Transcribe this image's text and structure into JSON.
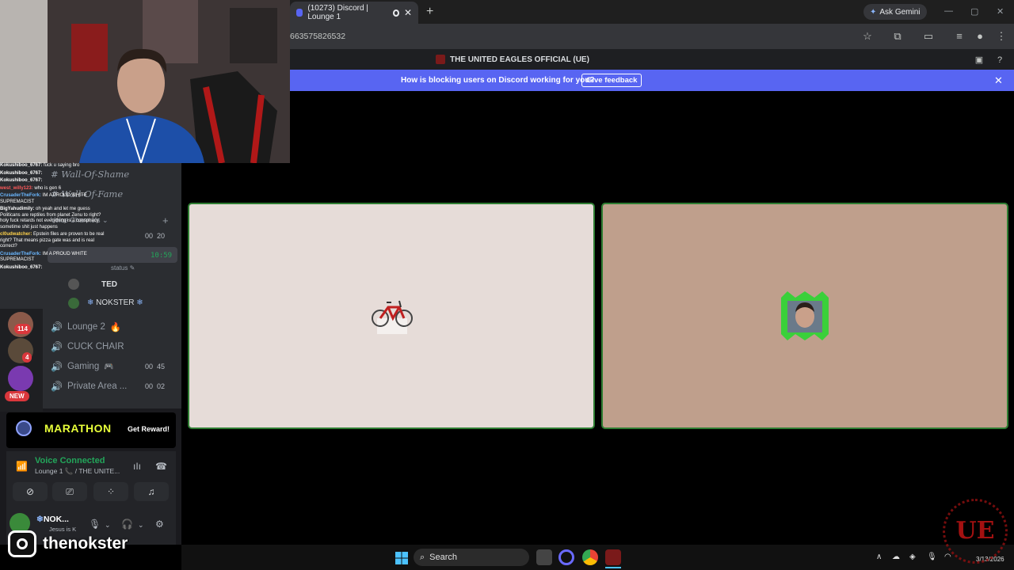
{
  "browser": {
    "tab_title": "(10273) Discord | Lounge 1",
    "tab_close": "✕",
    "new_tab": "+",
    "ask_gemini": "Ask Gemini",
    "url": "663575826532"
  },
  "discord": {
    "server_title": "THE UNITED EAGLES OFFICIAL (UE)",
    "feedback_text": "How is blocking users on Discord working for you?",
    "feedback_button": "Give feedback",
    "channels": {
      "wall_of_shame": "Wall-Of-Shame",
      "wall_of_fame": "Wall-Of-Fame",
      "category": "Voice Channels",
      "lounge_time": "10:59",
      "lounge2": "Lounge 2",
      "cuck_chair": "CUCK CHAIR",
      "gaming": "Gaming",
      "gaming_count_a": "00",
      "gaming_count_b": "45",
      "private": "Private Area ...",
      "private_count_a": "00",
      "private_count_b": "02",
      "top_count_a": "00",
      "top_count_b": "20",
      "member_nokster": "NOKSTER",
      "status_fragment": "status",
      "ted_fragment": "TED"
    },
    "servers": {
      "badge1": "114",
      "badge2": "4",
      "new_label": "NEW"
    },
    "promo": {
      "title": "MARATHON",
      "button": "Get Reward!"
    },
    "voice": {
      "title": "Voice Connected",
      "subtitle": "Lounge 1 📞 / THE UNITE..."
    },
    "user": {
      "name": "NOK...",
      "status": "Jesus is K"
    }
  },
  "chat_overlay": [
    {
      "user": "Kokushiboo_6767",
      "text": "fuck u saying bro",
      "color": "#ffffff"
    },
    {
      "user": "Kokushiboo_6767",
      "text": "",
      "color": "#ffffff"
    },
    {
      "user": "Kokushiboo_6767",
      "text": "",
      "color": "#ffffff"
    },
    {
      "user": "west_willy123",
      "text": "who is gen 6",
      "color": "#ff5a5a"
    },
    {
      "user": "CrusaderTheFork",
      "text": "IM A PROUD WHITE SUPREMACIST",
      "color": "#6ab7ff"
    },
    {
      "user": "BigYahudimily",
      "text": "oh yeah and let me guess Politicans are reptiles from planet Zenu to right? holy fuck retards not everything is a conspiracy sometime shit just happens",
      "color": "#ffffff"
    },
    {
      "user": "cl0udwatcher",
      "text": "Epstein files are proven to be real right? That means pizza gate was and is real correct?",
      "color": "#ffd24a"
    },
    {
      "user": "CrusaderTheFork",
      "text": "IM A PROUD WHITE SUPREMACIST",
      "color": "#6ab7ff"
    },
    {
      "user": "Kokushiboo_6767",
      "text": "",
      "color": "#ffffff"
    }
  ],
  "stream": {
    "instagram_handle": "thenokster",
    "watermark": "UE"
  },
  "taskbar": {
    "search": "Search",
    "date": "3/13/2026"
  },
  "colors": {
    "blurple": "#5865f2",
    "voice_green": "#23a55a",
    "tile_border": "#2e7d32",
    "badge_red": "#da373c"
  }
}
